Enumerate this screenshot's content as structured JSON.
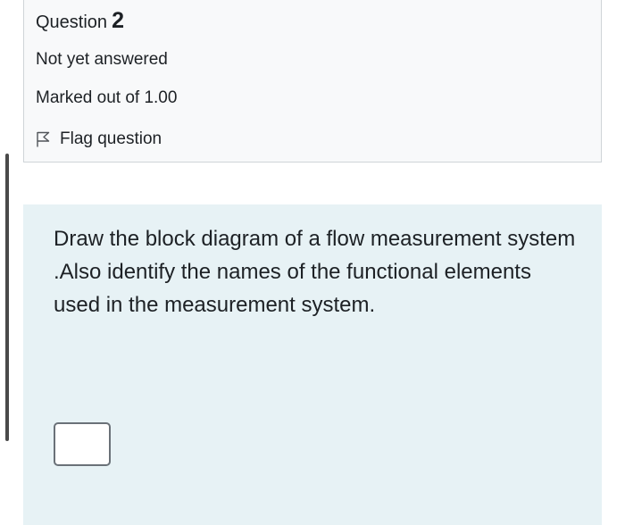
{
  "question": {
    "label": "Question",
    "number": "2",
    "state": "Not yet answered",
    "grade": "Marked out of 1.00",
    "flag_label": "Flag question",
    "flag_icon": "flag-icon"
  },
  "content": {
    "text": "Draw the block diagram of a flow measurement system .Also identify the names of the  functional elements used in the measurement system."
  },
  "colors": {
    "info_background": "#f8f9fa",
    "content_background": "#e7f2f5",
    "text": "#1d2125"
  }
}
